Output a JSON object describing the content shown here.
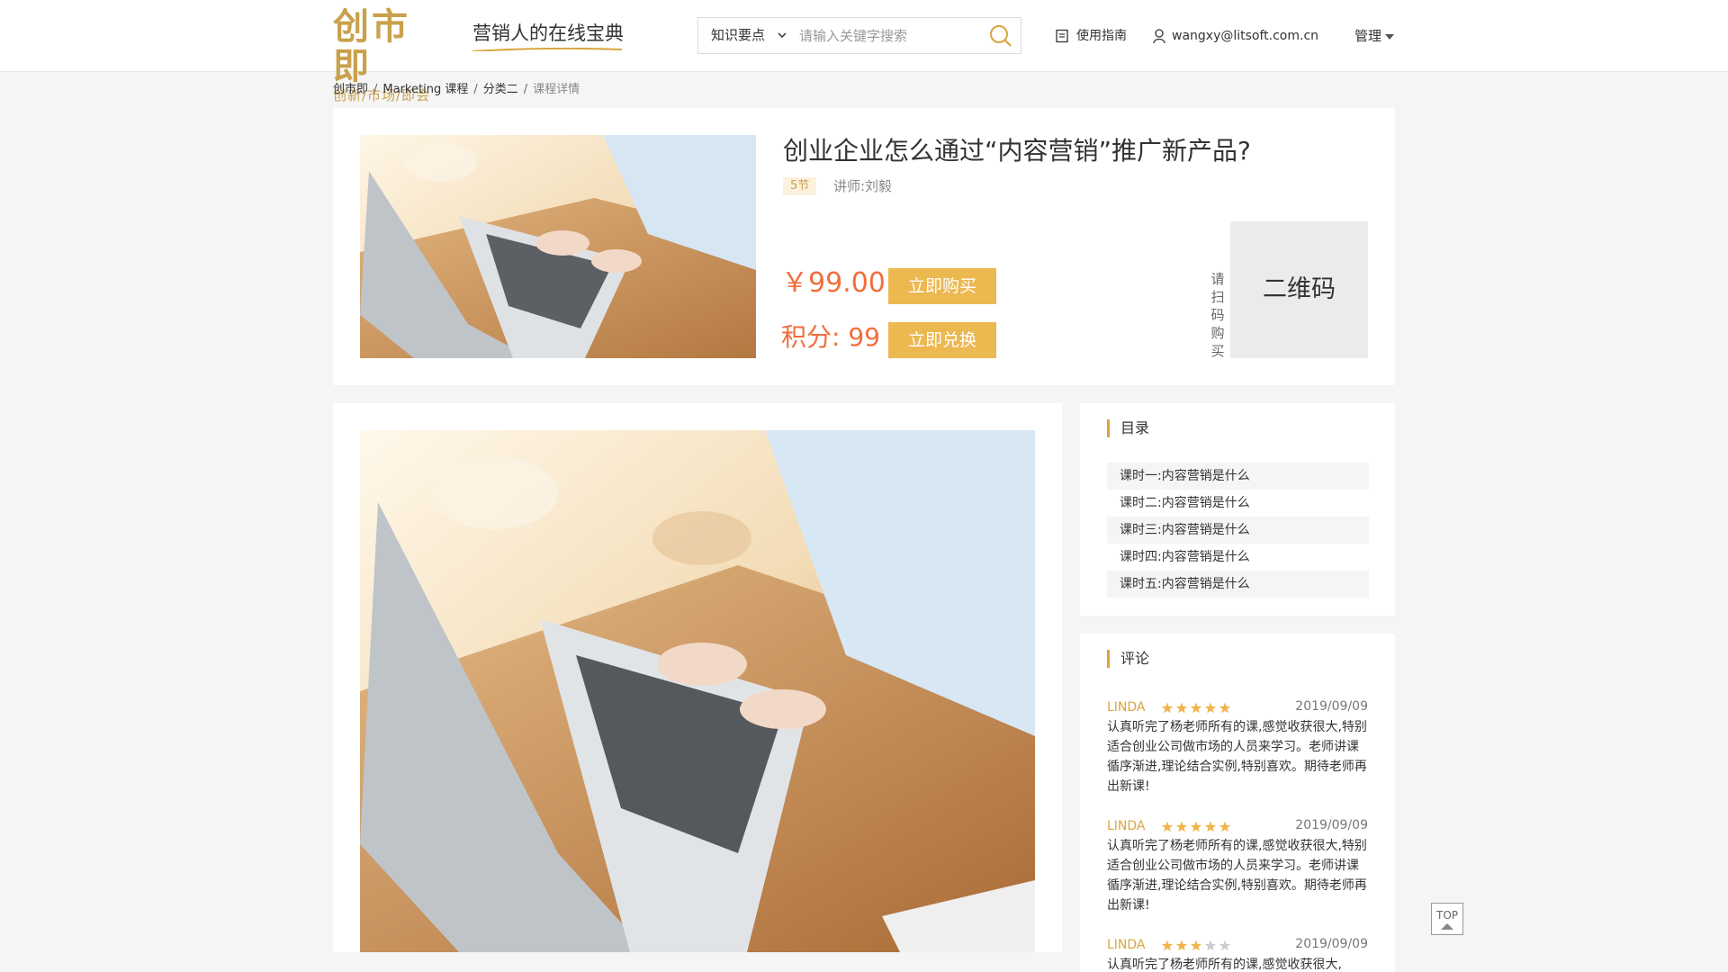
{
  "header": {
    "logo_main": "创市即",
    "logo_sub": "创新/市场/即会",
    "slogan": "营销人的在线宝典",
    "search": {
      "category": "知识要点",
      "placeholder": "请输入关键字搜索"
    },
    "guide_label": "使用指南",
    "user_email": "wangxy@litsoft.com.cn",
    "manage_label": "管理"
  },
  "breadcrumb": [
    "创市即",
    "Marketing 课程",
    "分类二",
    "课程详情"
  ],
  "course": {
    "title": "创业企业怎么通过“内容营销”推广新产品?",
    "lesson_count": "5节",
    "teacher": "讲师:刘毅",
    "price": "￥99.00",
    "buy_label": "立即购买",
    "points": "积分: 99",
    "redeem_label": "立即兑换",
    "scan_text": "请扫码购买",
    "qr_label": "二维码"
  },
  "toc": {
    "title": "目录",
    "items": [
      "课时一:内容营销是什么",
      "课时二:内容营销是什么",
      "课时三:内容营销是什么",
      "课时四:内容营销是什么",
      "课时五:内容营销是什么"
    ]
  },
  "reviews": {
    "title": "评论",
    "items": [
      {
        "user": "LINDA",
        "rating": 5,
        "date": "2019/09/09",
        "text": "认真听完了杨老师所有的课,感觉收获很大,特别适合创业公司做市场的人员来学习。老师讲课循序渐进,理论结合实例,特别喜欢。期待老师再出新课!"
      },
      {
        "user": "LINDA",
        "rating": 5,
        "date": "2019/09/09",
        "text": "认真听完了杨老师所有的课,感觉收获很大,特别适合创业公司做市场的人员来学习。老师讲课循序渐进,理论结合实例,特别喜欢。期待老师再出新课!"
      },
      {
        "user": "LINDA",
        "rating": 3,
        "date": "2019/09/09",
        "text": "认真听完了杨老师所有的课,感觉收获很大,"
      }
    ]
  },
  "top_label": "TOP",
  "colors": {
    "gold": "#c9a14a",
    "button": "#ecb850",
    "price": "#f16d3c",
    "star_on": "#f0b44a",
    "star_off": "#cccccc"
  }
}
